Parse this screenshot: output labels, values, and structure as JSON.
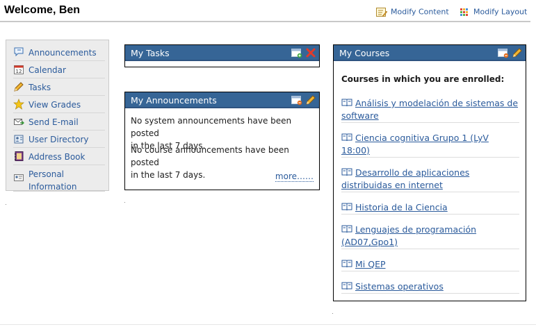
{
  "header": {
    "welcome": "Welcome, Ben",
    "modify_content": "Modify Content",
    "modify_layout": "Modify Layout"
  },
  "nav": {
    "items": [
      {
        "label": "Announcements",
        "icon": "speech-bubble-icon"
      },
      {
        "label": "Calendar",
        "icon": "calendar-icon"
      },
      {
        "label": "Tasks",
        "icon": "pencil-icon"
      },
      {
        "label": "View Grades",
        "icon": "star-icon"
      },
      {
        "label": "Send E-mail",
        "icon": "envelope-icon"
      },
      {
        "label": "User Directory",
        "icon": "directory-icon"
      },
      {
        "label": "Address Book",
        "icon": "address-book-icon"
      },
      {
        "label": "Personal",
        "label2": "Information",
        "icon": "personal-card-icon"
      }
    ]
  },
  "tasks": {
    "title": "My Tasks"
  },
  "announcements": {
    "title": "My Announcements",
    "system_line1": "No system announcements have been posted",
    "system_line2": "in the last 7 days.",
    "course_line1": "No course announcements have been posted",
    "course_line2": "in the last 7 days.",
    "more": "more……"
  },
  "courses": {
    "title": "My Courses",
    "heading": "Courses in which you are enrolled:",
    "list": [
      {
        "line1": "Análisis y modelación de sistemas de",
        "line2": "software"
      },
      {
        "line1": "Ciencia cognitiva Grupo 1 (LyV",
        "line2": "18:00)"
      },
      {
        "line1": "Desarrollo de aplicaciones",
        "line2": "distribuidas en internet"
      },
      {
        "line1": "Historia de la Ciencia",
        "line2": ""
      },
      {
        "line1": "Lenguajes de programación",
        "line2": "(AD07,Gpo1)"
      },
      {
        "line1": "Mi QEP",
        "line2": ""
      },
      {
        "line1": "Sistemas operativos",
        "line2": ""
      }
    ]
  },
  "colors": {
    "title_bar": "#366596",
    "link": "#2a5a9b",
    "nav_bg": "#ececec"
  }
}
